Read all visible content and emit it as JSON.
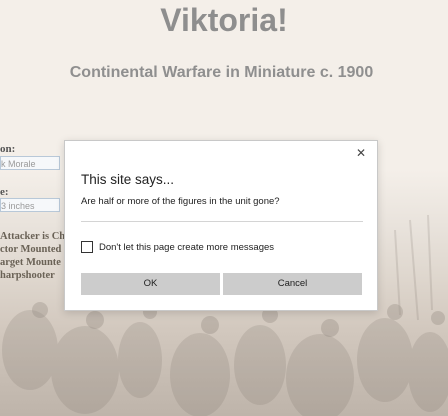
{
  "site": {
    "title": "Viktoria!",
    "subtitle": "Continental Warfare in Miniature c. 1900"
  },
  "form": {
    "field1_label": "on:",
    "field1_value": "k Morale",
    "field2_label": "e:",
    "field2_value": "3 inches"
  },
  "modifiers": [
    "Attacker is Ch",
    "ctor Mounted",
    "arget Mounte",
    "harpshooter"
  ],
  "dialog": {
    "heading": "This site says...",
    "message": "Are half or more of the figures in the unit gone?",
    "checkbox_label": "Don't let this page create more messages",
    "checkbox_checked": false,
    "ok_label": "OK",
    "cancel_label": "Cancel",
    "close_glyph": "✕"
  },
  "colors": {
    "title": "#8e8e8e",
    "button_bg": "#cccccc",
    "dialog_bg": "#ffffff"
  }
}
